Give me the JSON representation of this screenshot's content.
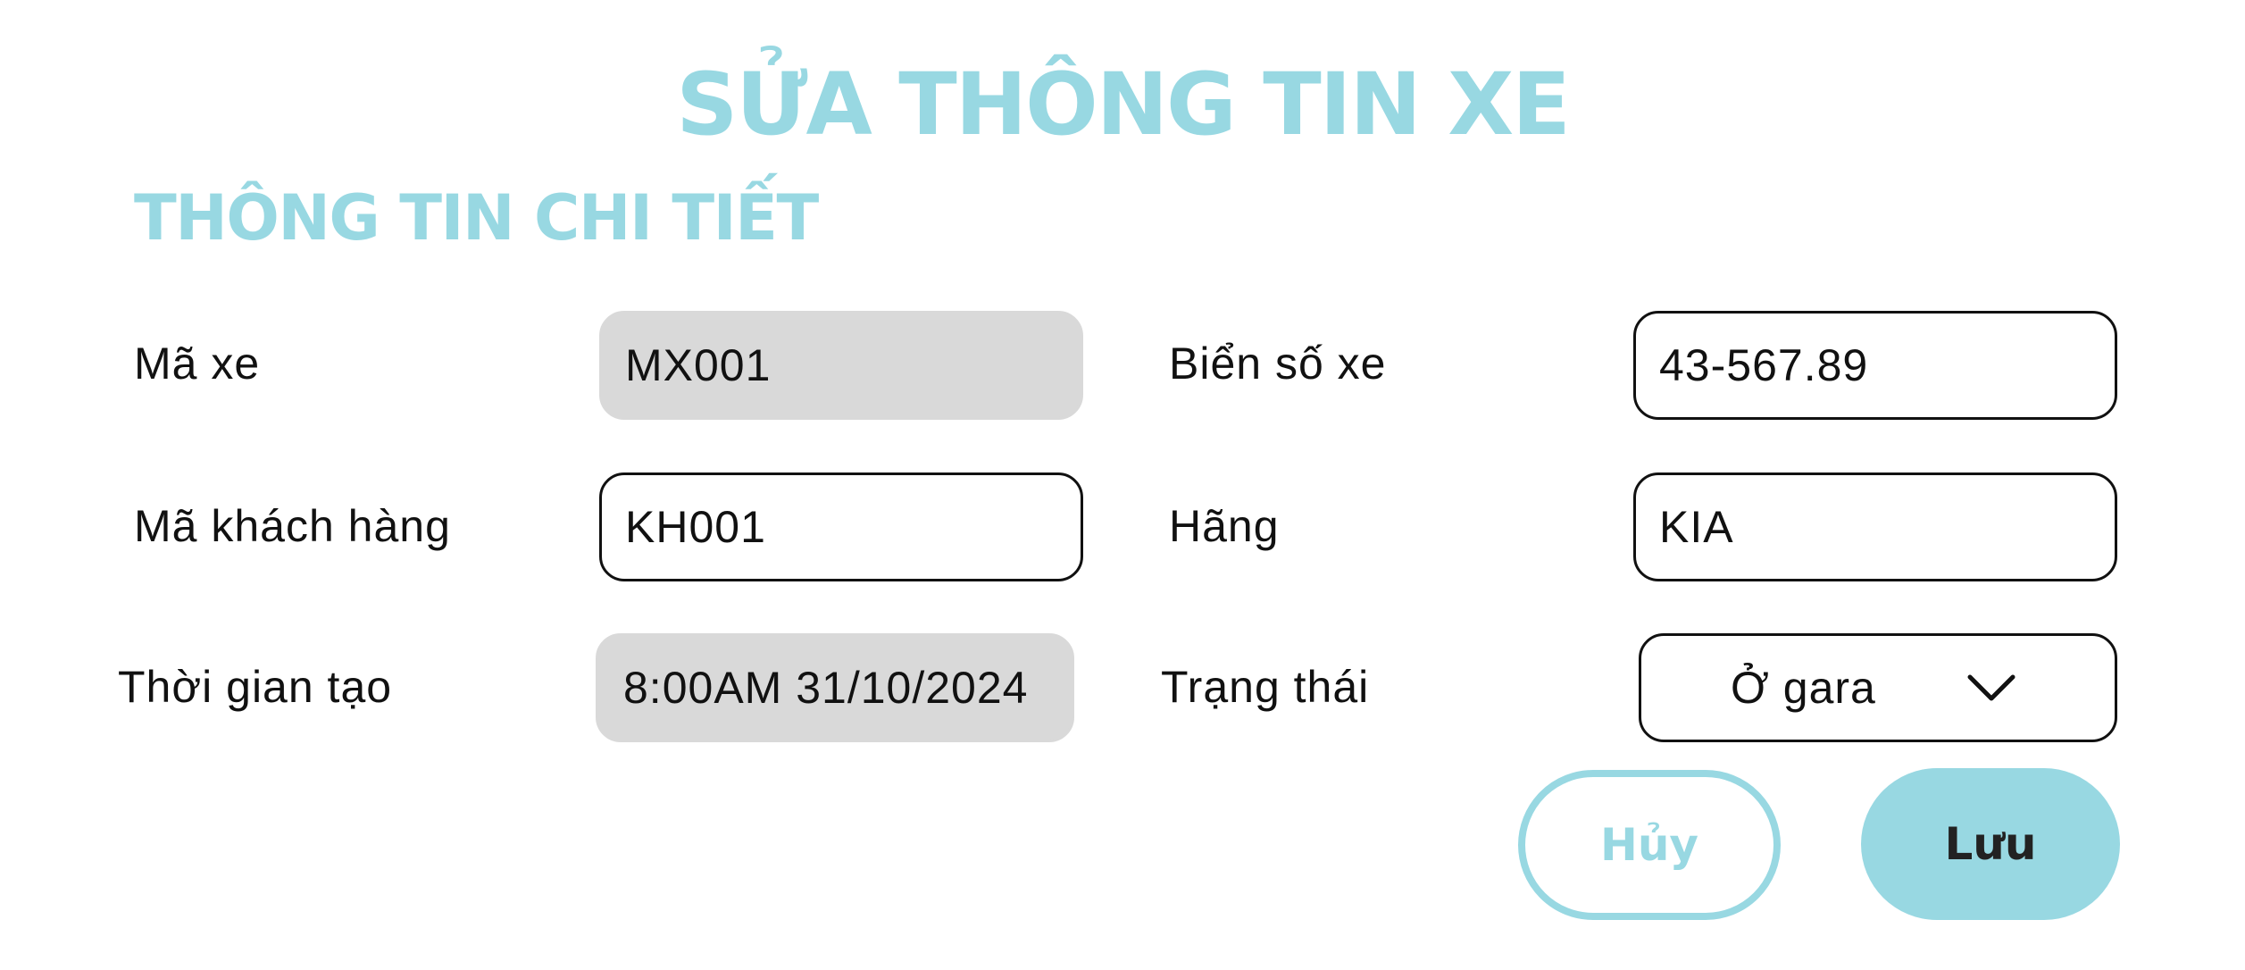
{
  "page": {
    "title": "SỬA THÔNG TIN XE",
    "section_title": "THÔNG TIN CHI TIẾT"
  },
  "form": {
    "vehicle_id": {
      "label": "Mã xe",
      "value": "MX001"
    },
    "license_plate": {
      "label": "Biển số xe",
      "value": "43-567.89"
    },
    "customer_id": {
      "label": "Mã khách hàng",
      "value": "KH001"
    },
    "brand": {
      "label": "Hãng",
      "value": "KIA"
    },
    "created_time": {
      "label": "Thời gian tạo",
      "value": "8:00AM 31/10/2024"
    },
    "status": {
      "label": "Trạng thái",
      "value": "Ở gara",
      "icon": "chevron-down-icon"
    }
  },
  "actions": {
    "cancel_label": "Hủy",
    "save_label": "Lưu"
  },
  "colors": {
    "accent": "#98d8e2",
    "readonly_background": "#d9d9d9",
    "text": "#111111"
  }
}
